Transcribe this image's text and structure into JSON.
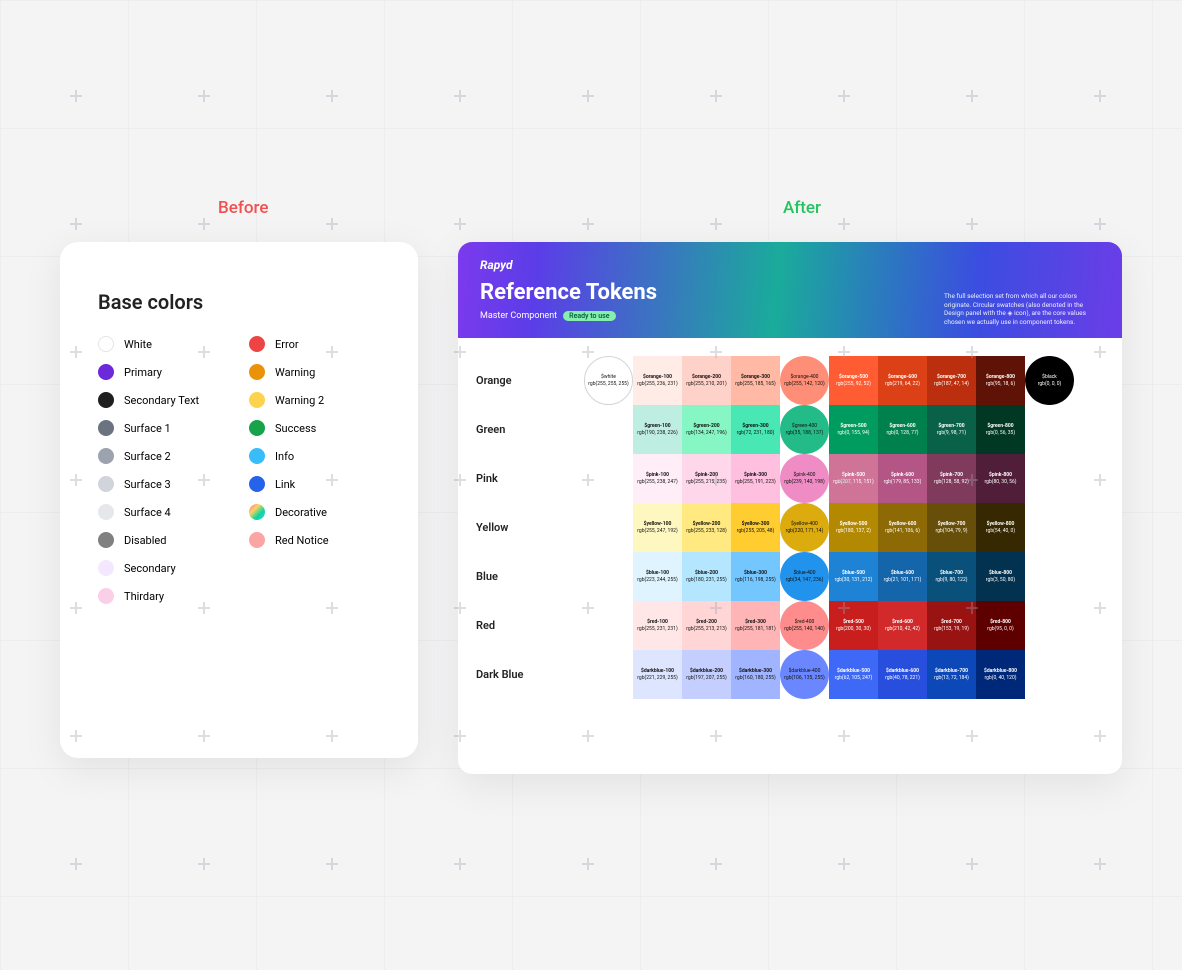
{
  "labels": {
    "before": "Before",
    "after": "After"
  },
  "before": {
    "title": "Base colors",
    "left": [
      {
        "name": "White",
        "color": "#ffffff",
        "white": true
      },
      {
        "name": "Primary",
        "color": "#6d28d9"
      },
      {
        "name": "Secondary Text",
        "color": "#1f1f1f"
      },
      {
        "name": "Surface 1",
        "color": "#6b7280"
      },
      {
        "name": "Surface 2",
        "color": "#9ca3af"
      },
      {
        "name": "Surface 3",
        "color": "#d1d5db"
      },
      {
        "name": "Surface 4",
        "color": "#e5e7eb"
      },
      {
        "name": "Disabled",
        "color": "#808080"
      },
      {
        "name": "Secondary",
        "color": "#f3e8ff"
      },
      {
        "name": "Thirdary",
        "color": "#fbcfe8"
      }
    ],
    "right": [
      {
        "name": "Error",
        "color": "#ef4444"
      },
      {
        "name": "Warning",
        "color": "#ea930a"
      },
      {
        "name": "Warning 2",
        "color": "#fcd34d"
      },
      {
        "name": "Success",
        "color": "#16a34a"
      },
      {
        "name": "Info",
        "color": "#38bdf8"
      },
      {
        "name": "Link",
        "color": "#2563eb"
      },
      {
        "name": "Decorative",
        "color": "",
        "decorative": true
      },
      {
        "name": "Red Notice",
        "color": "#fca5a5"
      }
    ]
  },
  "after": {
    "brand": "Rapyd",
    "title": "Reference Tokens",
    "subtitle": "Master Component",
    "pill": "Ready to use",
    "description": "The full selection set from which all our colors originate. Circular swatches (also denoted in the Design panel with the ◈ icon), are the core values chosen we actually use in component tokens.",
    "special": {
      "white": {
        "name": "$white",
        "rgb": "rgb(255, 255, 255)"
      },
      "black": {
        "name": "$black",
        "rgb": "rgb(0, 0, 0)"
      }
    },
    "rows": [
      {
        "label": "Orange",
        "circleIndex": 3,
        "cells": [
          {
            "name": "$orange-100",
            "rgb": "rgb(255, 236, 231)",
            "bg": "#ffece7",
            "text": "dark"
          },
          {
            "name": "$orange-200",
            "rgb": "rgb(255, 210, 201)",
            "bg": "#ffd2c9",
            "text": "dark"
          },
          {
            "name": "$orange-300",
            "rgb": "rgb(255, 185, 165)",
            "bg": "#ffb9a5",
            "text": "dark"
          },
          {
            "name": "$orange-400",
            "rgb": "rgb(255, 142, 120)",
            "bg": "#ff8e78",
            "text": "dark"
          },
          {
            "name": "$orange-500",
            "rgb": "rgb(255, 92, 52)",
            "bg": "#ff5c34",
            "text": "light"
          },
          {
            "name": "$orange-600",
            "rgb": "rgb(219, 64, 22)",
            "bg": "#db4016",
            "text": "light"
          },
          {
            "name": "$orange-700",
            "rgb": "rgb(187, 47, 14)",
            "bg": "#bb2f0e",
            "text": "light"
          },
          {
            "name": "$orange-800",
            "rgb": "rgb(95, 18, 6)",
            "bg": "#5f1206",
            "text": "light"
          }
        ]
      },
      {
        "label": "Green",
        "circleIndex": 3,
        "cells": [
          {
            "name": "$green-100",
            "rgb": "rgb(190, 238, 226)",
            "bg": "#beeee2",
            "text": "dark"
          },
          {
            "name": "$green-200",
            "rgb": "rgb(134, 247, 196)",
            "bg": "#86f7c4",
            "text": "dark"
          },
          {
            "name": "$green-300",
            "rgb": "rgb(72, 231, 180)",
            "bg": "#48e7b4",
            "text": "dark"
          },
          {
            "name": "$green-400",
            "rgb": "rgb(35, 188, 137)",
            "bg": "#23bc89",
            "text": "dark"
          },
          {
            "name": "$green-500",
            "rgb": "rgb(0, 155, 94)",
            "bg": "#009b5e",
            "text": "light"
          },
          {
            "name": "$green-600",
            "rgb": "rgb(0, 128, 77)",
            "bg": "#00804d",
            "text": "light"
          },
          {
            "name": "$green-700",
            "rgb": "rgb(9, 98, 71)",
            "bg": "#096247",
            "text": "light"
          },
          {
            "name": "$green-800",
            "rgb": "rgb(0, 56, 35)",
            "bg": "#003823",
            "text": "light"
          }
        ]
      },
      {
        "label": "Pink",
        "circleIndex": 3,
        "cells": [
          {
            "name": "$pink-100",
            "rgb": "rgb(255, 238, 247)",
            "bg": "#ffeef7",
            "text": "dark"
          },
          {
            "name": "$pink-200",
            "rgb": "rgb(255, 215, 235)",
            "bg": "#ffd7eb",
            "text": "dark"
          },
          {
            "name": "$pink-300",
            "rgb": "rgb(255, 191, 223)",
            "bg": "#ffbfdf",
            "text": "dark"
          },
          {
            "name": "$pink-400",
            "rgb": "rgb(239, 140, 198)",
            "bg": "#ef8cc6",
            "text": "dark"
          },
          {
            "name": "$pink-500",
            "rgb": "rgb(207, 115, 151)",
            "bg": "#cf7397",
            "text": "light"
          },
          {
            "name": "$pink-600",
            "rgb": "rgb(179, 85, 133)",
            "bg": "#b35585",
            "text": "light"
          },
          {
            "name": "$pink-700",
            "rgb": "rgb(128, 58, 92)",
            "bg": "#803a5c",
            "text": "light"
          },
          {
            "name": "$pink-800",
            "rgb": "rgb(80, 30, 56)",
            "bg": "#501e38",
            "text": "light"
          }
        ]
      },
      {
        "label": "Yellow",
        "circleIndex": 3,
        "cells": [
          {
            "name": "$yellow-100",
            "rgb": "rgb(255, 247, 192)",
            "bg": "#fff7c0",
            "text": "dark"
          },
          {
            "name": "$yellow-200",
            "rgb": "rgb(255, 233, 128)",
            "bg": "#ffe980",
            "text": "dark"
          },
          {
            "name": "$yellow-300",
            "rgb": "rgb(255, 205, 48)",
            "bg": "#ffcd30",
            "text": "dark"
          },
          {
            "name": "$yellow-400",
            "rgb": "rgb(220, 171, 14)",
            "bg": "#dcab0e",
            "text": "dark"
          },
          {
            "name": "$yellow-500",
            "rgb": "rgb(180, 137, 2)",
            "bg": "#b48902",
            "text": "light"
          },
          {
            "name": "$yellow-600",
            "rgb": "rgb(141, 106, 6)",
            "bg": "#8d6a06",
            "text": "light"
          },
          {
            "name": "$yellow-700",
            "rgb": "rgb(104, 79, 9)",
            "bg": "#684f09",
            "text": "light"
          },
          {
            "name": "$yellow-800",
            "rgb": "rgb(54, 40, 0)",
            "bg": "#362800",
            "text": "light"
          }
        ]
      },
      {
        "label": "Blue",
        "circleIndex": 3,
        "cells": [
          {
            "name": "$blue-100",
            "rgb": "rgb(223, 244, 255)",
            "bg": "#dff4ff",
            "text": "dark"
          },
          {
            "name": "$blue-200",
            "rgb": "rgb(180, 231, 255)",
            "bg": "#b4e7ff",
            "text": "dark"
          },
          {
            "name": "$blue-300",
            "rgb": "rgb(116, 198, 255)",
            "bg": "#74c6ff",
            "text": "dark"
          },
          {
            "name": "$blue-400",
            "rgb": "rgb(34, 147, 236)",
            "bg": "#2293ec",
            "text": "dark"
          },
          {
            "name": "$blue-500",
            "rgb": "rgb(30, 131, 212)",
            "bg": "#1e83d4",
            "text": "light"
          },
          {
            "name": "$blue-600",
            "rgb": "rgb(21, 101, 171)",
            "bg": "#1565ab",
            "text": "light"
          },
          {
            "name": "$blue-700",
            "rgb": "rgb(9, 80, 122)",
            "bg": "#09507a",
            "text": "light"
          },
          {
            "name": "$blue-800",
            "rgb": "rgb(3, 50, 80)",
            "bg": "#033250",
            "text": "light"
          }
        ]
      },
      {
        "label": "Red",
        "circleIndex": 3,
        "cells": [
          {
            "name": "$red-100",
            "rgb": "rgb(255, 231, 231)",
            "bg": "#ffe7e7",
            "text": "dark"
          },
          {
            "name": "$red-200",
            "rgb": "rgb(255, 213, 213)",
            "bg": "#ffd5d5",
            "text": "dark"
          },
          {
            "name": "$red-300",
            "rgb": "rgb(255, 181, 181)",
            "bg": "#ffb5b5",
            "text": "dark"
          },
          {
            "name": "$red-400",
            "rgb": "rgb(255, 140, 140)",
            "bg": "#ff8c8c",
            "text": "dark"
          },
          {
            "name": "$red-500",
            "rgb": "rgb(200, 30, 30)",
            "bg": "#c81e1e",
            "text": "light"
          },
          {
            "name": "$red-600",
            "rgb": "rgb(210, 42, 42)",
            "bg": "#d22a2a",
            "text": "light"
          },
          {
            "name": "$red-700",
            "rgb": "rgb(153, 19, 19)",
            "bg": "#991313",
            "text": "light"
          },
          {
            "name": "$red-800",
            "rgb": "rgb(95, 0, 0)",
            "bg": "#5f0000",
            "text": "light"
          }
        ]
      },
      {
        "label": "Dark Blue",
        "circleIndex": 3,
        "cells": [
          {
            "name": "$darkblue-100",
            "rgb": "rgb(221, 229, 255)",
            "bg": "#dde5ff",
            "text": "dark"
          },
          {
            "name": "$darkblue-200",
            "rgb": "rgb(197, 207, 255)",
            "bg": "#c5cfff",
            "text": "dark"
          },
          {
            "name": "$darkblue-300",
            "rgb": "rgb(160, 180, 255)",
            "bg": "#a0b4ff",
            "text": "dark"
          },
          {
            "name": "$darkblue-400",
            "rgb": "rgb(106, 135, 255)",
            "bg": "#6a87ff",
            "text": "dark"
          },
          {
            "name": "$darkblue-500",
            "rgb": "rgb(62, 105, 247)",
            "bg": "#3e69f7",
            "text": "light"
          },
          {
            "name": "$darkblue-600",
            "rgb": "rgb(40, 78, 221)",
            "bg": "#284edd",
            "text": "light"
          },
          {
            "name": "$darkblue-700",
            "rgb": "rgb(13, 72, 184)",
            "bg": "#0d48b8",
            "text": "light"
          },
          {
            "name": "$darkblue-800",
            "rgb": "rgb(0, 40, 120)",
            "bg": "#002878",
            "text": "light"
          }
        ]
      }
    ]
  }
}
